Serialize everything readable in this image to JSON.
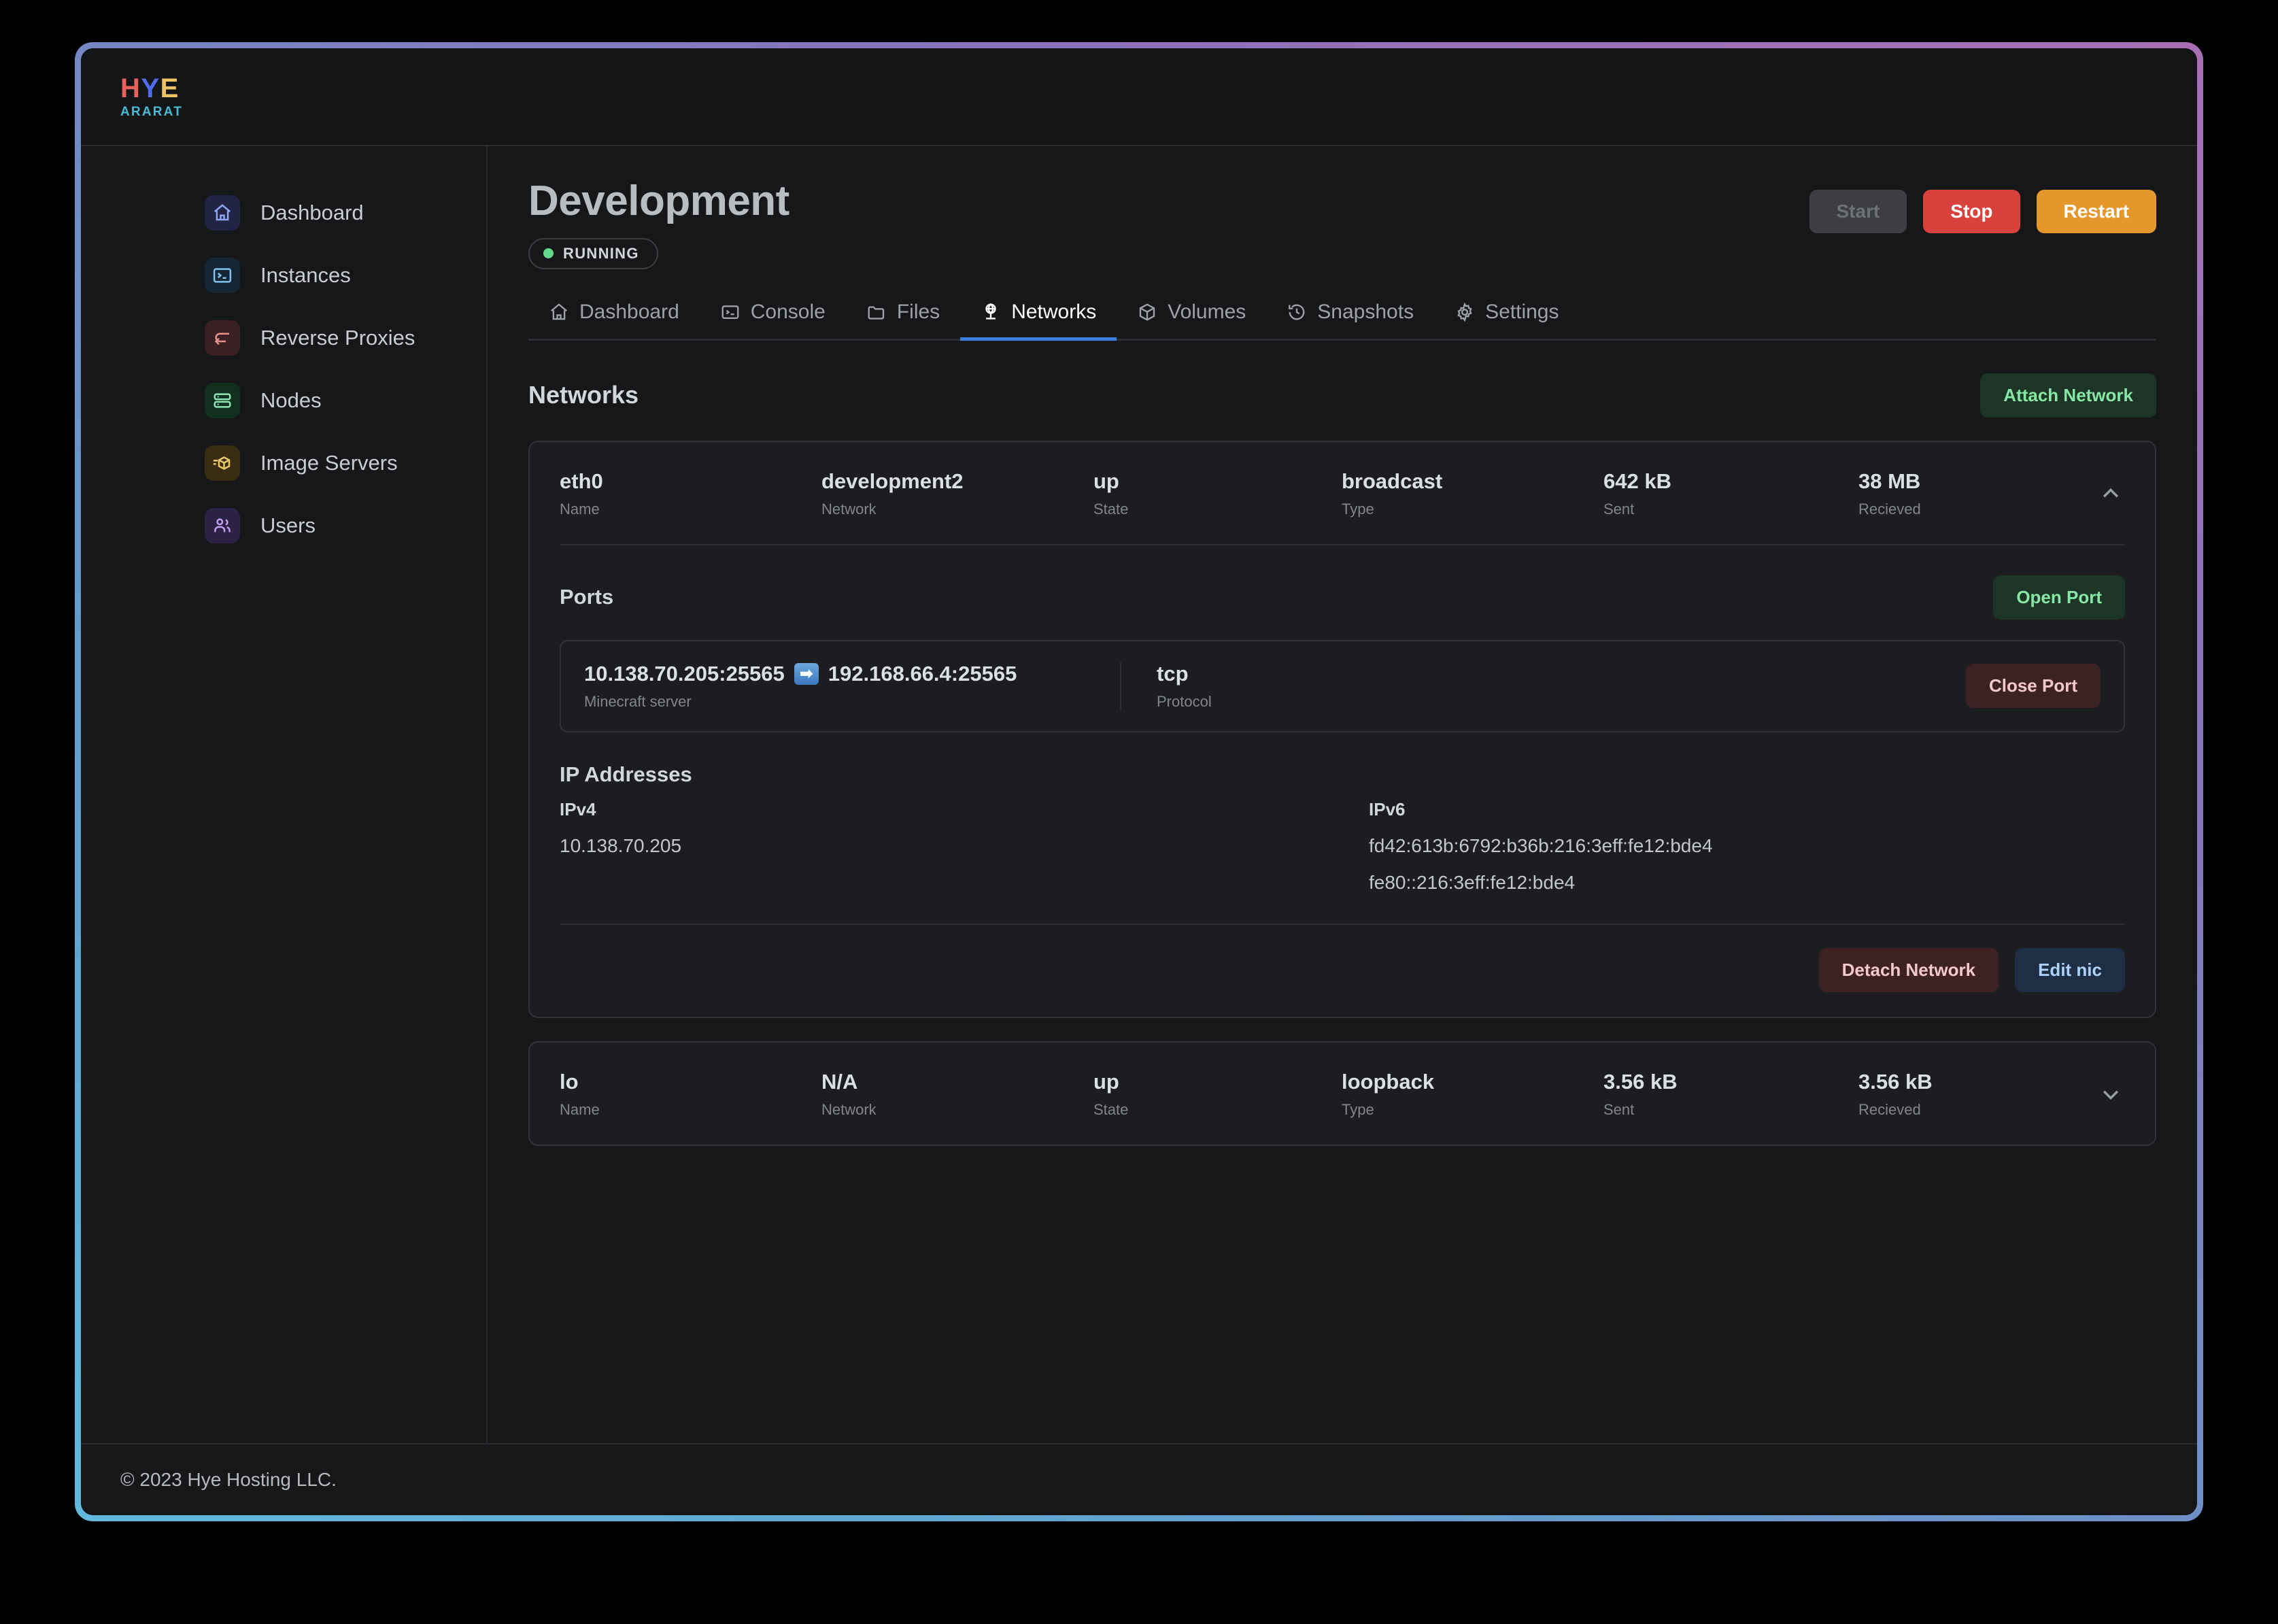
{
  "brand": {
    "logo_h": "H",
    "logo_y": "Y",
    "logo_e": "E",
    "logo_sub": "ARARAT",
    "color_h": "#e8615c",
    "color_y": "#4f6bf0",
    "color_e": "#f0c263",
    "color_sub": "#49b9d6"
  },
  "sidebar": {
    "items": [
      {
        "label": "Dashboard",
        "icon": "home-icon",
        "icon_color": "#8fa4f5",
        "icon_bg": "#222445"
      },
      {
        "label": "Instances",
        "icon": "terminal-icon",
        "icon_color": "#7fc2ee",
        "icon_bg": "#152735"
      },
      {
        "label": "Reverse Proxies",
        "icon": "arrow-return-icon",
        "icon_color": "#e8918d",
        "icon_bg": "#3a2023"
      },
      {
        "label": "Nodes",
        "icon": "server-icon",
        "icon_color": "#8fe2b2",
        "icon_bg": "#12301f"
      },
      {
        "label": "Image Servers",
        "icon": "image-server-icon",
        "icon_color": "#e8c867",
        "icon_bg": "#3a2c12"
      },
      {
        "label": "Users",
        "icon": "users-icon",
        "icon_color": "#c49ef0",
        "icon_bg": "#2c2244"
      }
    ]
  },
  "header": {
    "title": "Development",
    "status": "RUNNING",
    "status_color": "#63d98b",
    "buttons": {
      "start": "Start",
      "stop": "Stop",
      "restart": "Restart"
    },
    "button_colors": {
      "start_bg": "#3c3e43",
      "stop_bg": "#d9413c",
      "restart_bg": "#e5972c"
    }
  },
  "tabs": [
    {
      "label": "Dashboard",
      "icon": "home-icon",
      "active": false
    },
    {
      "label": "Console",
      "icon": "terminal-icon",
      "active": false
    },
    {
      "label": "Files",
      "icon": "folder-icon",
      "active": false
    },
    {
      "label": "Networks",
      "icon": "network-globe-icon",
      "active": true
    },
    {
      "label": "Volumes",
      "icon": "cube-icon",
      "active": false
    },
    {
      "label": "Snapshots",
      "icon": "clock-history-icon",
      "active": false
    },
    {
      "label": "Settings",
      "icon": "gear-icon",
      "active": false
    }
  ],
  "networks_section": {
    "title": "Networks",
    "attach_button": "Attach Network"
  },
  "column_labels": {
    "name": "Name",
    "network": "Network",
    "state": "State",
    "type": "Type",
    "sent": "Sent",
    "received": "Recieved"
  },
  "interfaces": [
    {
      "name": "eth0",
      "network": "development2",
      "state": "up",
      "type": "broadcast",
      "sent": "642 kB",
      "received": "38 MB",
      "expanded": true,
      "chevron": "chevron-up-icon"
    },
    {
      "name": "lo",
      "network": "N/A",
      "state": "up",
      "type": "loopback",
      "sent": "3.56 kB",
      "received": "3.56 kB",
      "expanded": false,
      "chevron": "chevron-down-icon"
    }
  ],
  "ports_section": {
    "title": "Ports",
    "open_button": "Open Port",
    "close_button": "Close Port",
    "protocol_label": "Protocol",
    "entry": {
      "listen_address": "10.138.70.205:25565",
      "arrow": "➡",
      "target_address": "192.168.66.4:25565",
      "description": "Minecraft server",
      "protocol": "tcp"
    }
  },
  "ip_section": {
    "title": "IP Addresses",
    "ipv4_label": "IPv4",
    "ipv4_value": "10.138.70.205",
    "ipv6_label": "IPv6",
    "ipv6_value_1": "fd42:613b:6792:b36b:216:3eff:fe12:bde4",
    "ipv6_value_2": "fe80::216:3eff:fe12:bde4"
  },
  "card_actions": {
    "detach": "Detach Network",
    "edit_nic": "Edit nic"
  },
  "footer": {
    "text": "© 2023 Hye Hosting LLC."
  }
}
